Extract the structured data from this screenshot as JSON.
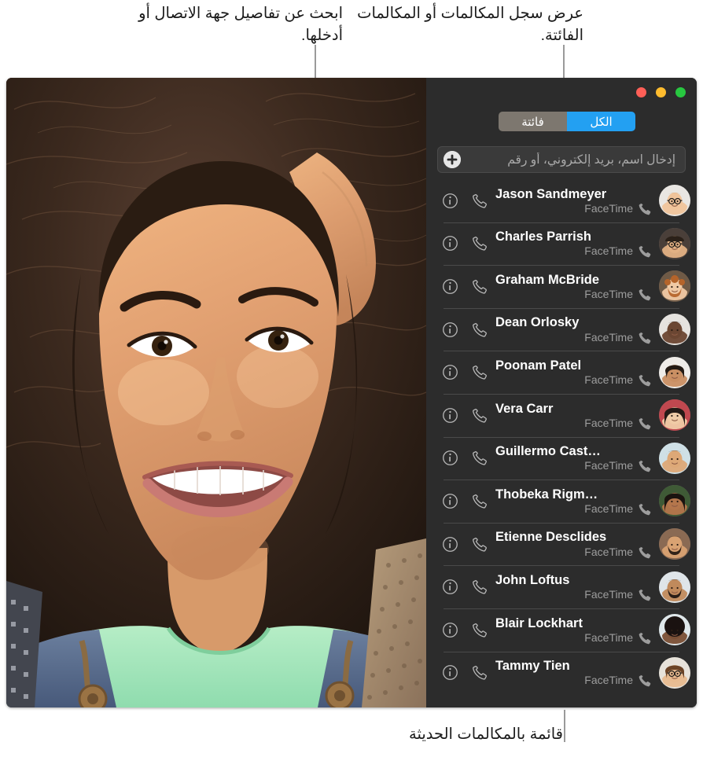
{
  "annotations": {
    "search_hint": "ابحث عن تفاصيل جهة الاتصال أو أدخلها.",
    "tabs_hint": "عرض سجل المكالمات أو المكالمات الفائتة.",
    "recents_hint": "قائمة بالمكالمات الحديثة"
  },
  "window": {
    "traffic_lights": {
      "close_label": "إغلاق",
      "minimize_label": "تصغير",
      "zoom_label": "تكبير",
      "close_color": "#ff5f57",
      "minimize_color": "#febc2e",
      "zoom_color": "#28c840"
    },
    "photo_alt": "صورة شخصية"
  },
  "segmented_control": {
    "selected": "الكل",
    "accent_color": "#23a0f2",
    "inactive_color": "#7d776f",
    "options": [
      {
        "label": "فائتة",
        "selected": false
      },
      {
        "label": "الكل",
        "selected": true
      }
    ]
  },
  "search": {
    "placeholder": "إدخال اسم، بريد إلكتروني، أو رقم",
    "value": "",
    "add_label": "إضافة"
  },
  "recents": {
    "service_label": "FaceTime",
    "rows": [
      {
        "name": "Jason Sandmeyer",
        "service": "FaceTime",
        "avatar": "jason"
      },
      {
        "name": "Charles Parrish",
        "service": "FaceTime",
        "avatar": "charles"
      },
      {
        "name": "Graham McBride",
        "service": "FaceTime",
        "avatar": "graham"
      },
      {
        "name": "Dean Orlosky",
        "service": "FaceTime",
        "avatar": "dean"
      },
      {
        "name": "Poonam Patel",
        "service": "FaceTime",
        "avatar": "poonam"
      },
      {
        "name": "Vera Carr",
        "service": "FaceTime",
        "avatar": "vera"
      },
      {
        "name": "Guillermo Cast…",
        "service": "FaceTime",
        "avatar": "guillermo"
      },
      {
        "name": "Thobeka Rigm…",
        "service": "FaceTime",
        "avatar": "thobeka"
      },
      {
        "name": "Etienne Desclides",
        "service": "FaceTime",
        "avatar": "etienne"
      },
      {
        "name": "John Loftus",
        "service": "FaceTime",
        "avatar": "john"
      },
      {
        "name": "Blair Lockhart",
        "service": "FaceTime",
        "avatar": "blair"
      },
      {
        "name": "Tammy Tien",
        "service": "FaceTime",
        "avatar": "tammy"
      }
    ],
    "call_icon_label": "اتصال",
    "info_icon_label": "معلومات"
  }
}
